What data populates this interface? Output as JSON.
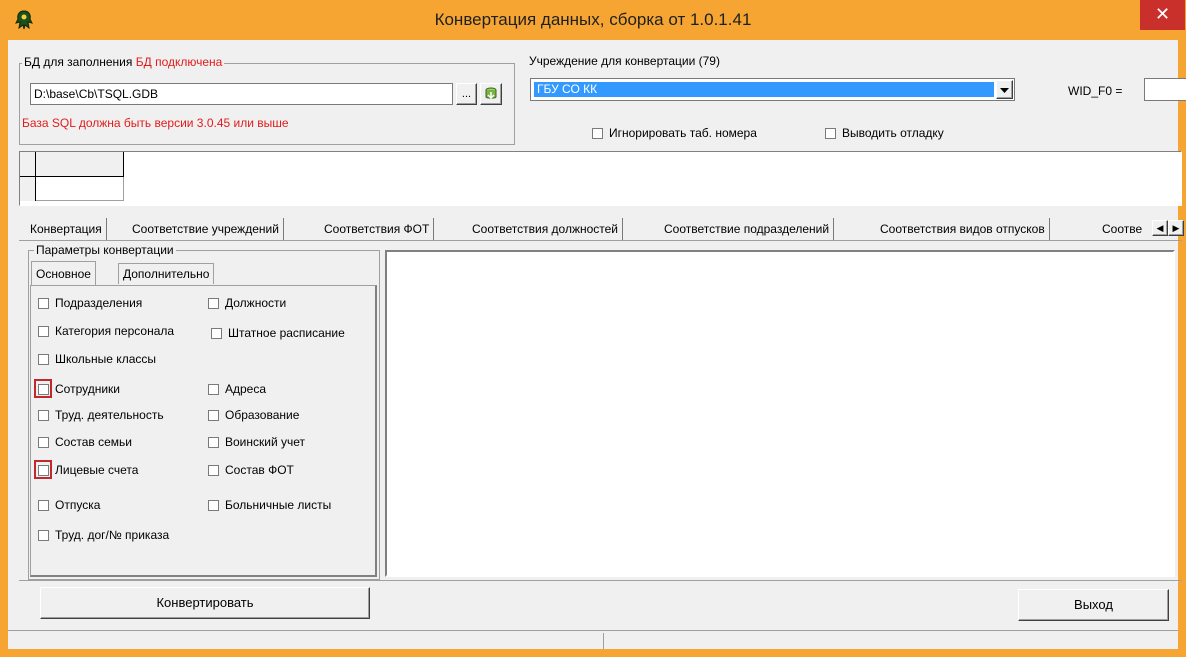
{
  "window": {
    "title": "Конвертация данных, сборка от 1.0.1.41",
    "close_glyph": "✕",
    "frame_color": "#f6a532"
  },
  "db_group": {
    "label": "БД для заполнения",
    "status": "БД подключена",
    "path_value": "D:\\base\\Cb\\TSQL.GDB",
    "browse_label": "...",
    "connect_icon": "db-connect-icon",
    "warning": "База SQL должна быть версии 3.0.45 или выше"
  },
  "institution": {
    "label": "Учреждение для конвертации (79)",
    "selected": "ГБУ СО КК",
    "wid_label": "WID_F0 =",
    "wid_value": ""
  },
  "options": {
    "ignore_tab_numbers": "Игнорировать таб. номера",
    "debug_output": "Выводить отладку"
  },
  "tabs": [
    "Конвертация",
    "Соответствие учреждений",
    "Соответствия ФОТ",
    "Соответствия должностей",
    "Соответствие подразделений",
    "Соответствия видов отпусков",
    "Соотве"
  ],
  "params": {
    "group_label": "Параметры конвертации",
    "subtabs": [
      "Основное",
      "Дополнительно"
    ],
    "left_col": [
      "Подразделения",
      "Категория персонала",
      "Школьные классы",
      "Сотрудники",
      "Труд. деятельность",
      "Состав семьи",
      "Лицевые счета",
      "Отпуска",
      "Труд. дог/№ приказа"
    ],
    "right_col": [
      "Должности",
      "Штатное расписание",
      "Адреса",
      "Образование",
      "Воинский учет",
      "Состав ФОТ",
      "Больничные листы"
    ],
    "highlight_color": "#c0282d"
  },
  "buttons": {
    "convert": "Конвертировать",
    "exit": "Выход"
  },
  "colors": {
    "status_red": "#e31b1b",
    "selection_blue": "#3399ff"
  }
}
